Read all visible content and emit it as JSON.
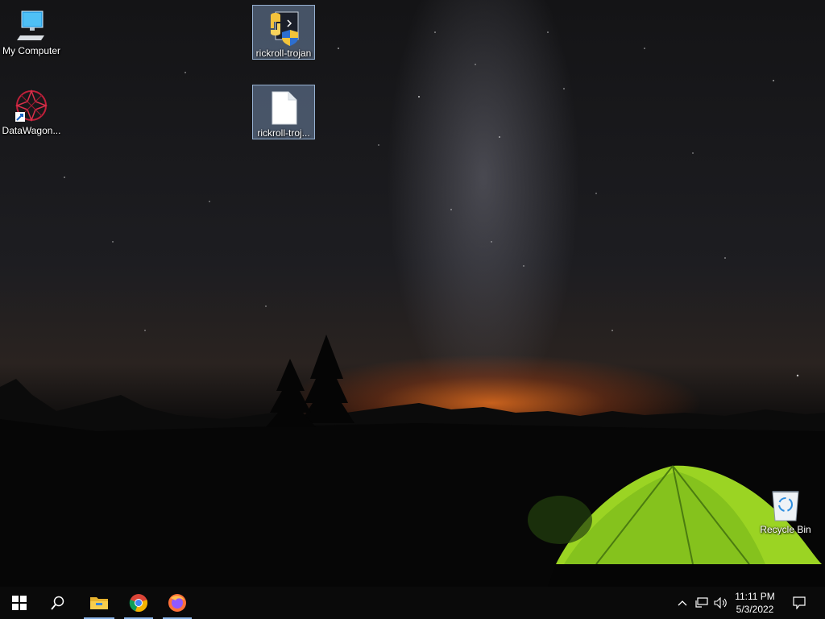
{
  "desktop_icons": [
    {
      "label": "My Computer",
      "icon": "computer-icon"
    },
    {
      "label": "DataWagon...",
      "icon": "datawagon-shortcut-icon"
    },
    {
      "label": "rickroll-trojan",
      "icon": "python-script-icon"
    },
    {
      "label": "rickroll-troj...",
      "icon": "blank-file-icon"
    },
    {
      "label": "Recycle Bin",
      "icon": "recycle-bin-icon"
    }
  ],
  "taskbar": {
    "apps": [
      "start-icon",
      "search-icon",
      "file-explorer-icon",
      "chrome-icon",
      "firefox-icon"
    ],
    "tray_icons": [
      "show-hidden-icons-chevron",
      "network-icon",
      "volume-icon"
    ],
    "time": "11:11 PM",
    "date": "5/3/2022"
  },
  "colors": {
    "taskbar": "#0a0a0a",
    "selection": "#5d7fa8",
    "tent": "#9bd423"
  }
}
